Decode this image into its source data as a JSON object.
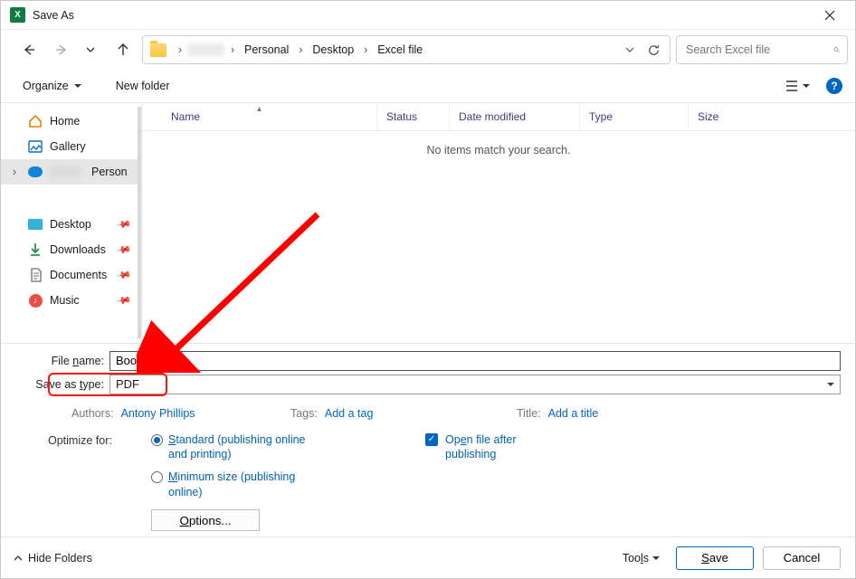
{
  "window": {
    "title": "Save As"
  },
  "breadcrumbs": {
    "b1": "Personal",
    "b2": "Desktop",
    "b3": "Excel file"
  },
  "search": {
    "placeholder": "Search Excel file"
  },
  "toolbar": {
    "organize": "Organize",
    "new_folder": "New folder"
  },
  "sidebar": {
    "home": "Home",
    "gallery": "Gallery",
    "personal": "Person",
    "desktop": "Desktop",
    "downloads": "Downloads",
    "documents": "Documents",
    "music": "Music"
  },
  "columns": {
    "name": "Name",
    "status": "Status",
    "date": "Date modified",
    "type": "Type",
    "size": "Size"
  },
  "list": {
    "empty": "No items match your search."
  },
  "form": {
    "filename_label_pre": "File ",
    "filename_label_ul": "n",
    "filename_label_post": "ame:",
    "filename_value": "Book1",
    "type_label_pre": "Save as ",
    "type_label_ul": "t",
    "type_label_post": "ype:",
    "type_value": "PDF"
  },
  "meta": {
    "authors_label": "Authors:",
    "authors_value": "Antony Phillips",
    "tags_label": "Tags:",
    "tags_value": "Add a tag",
    "title_label": "Title:",
    "title_value": "Add a title"
  },
  "optimize": {
    "label": "Optimize for:",
    "opt1_pre1": "S",
    "opt1_pre2": "tandard (publishing online and printing)",
    "opt2_pre1": "M",
    "opt2_pre2": "inimum size (publishing online)",
    "openfile_pre": "Op",
    "openfile_ul": "e",
    "openfile_post": "n file after publishing",
    "options_pre": "O",
    "options_post": "ptions..."
  },
  "footer": {
    "hide_folders": "Hide Folders",
    "tools_pre": "Too",
    "tools_ul": "l",
    "tools_post": "s",
    "save_ul": "S",
    "save_post": "ave",
    "cancel": "Cancel"
  }
}
